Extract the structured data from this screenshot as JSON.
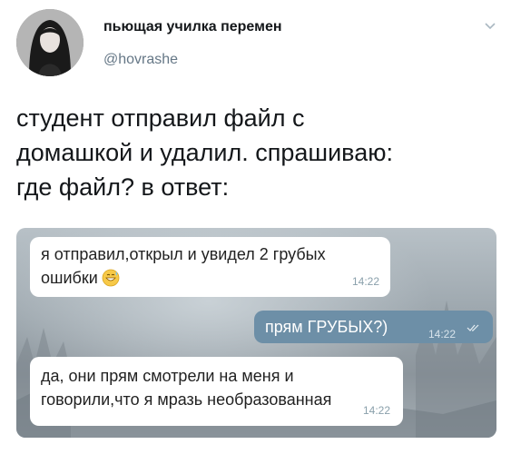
{
  "tweet": {
    "display_name": "пьющая училка перемен",
    "handle": "@hovrashe",
    "text": "студент отправил файл с\nдомашкой и удалил. спрашиваю:\nгде файл? в ответ:",
    "menu_icon": "chevron-down-icon"
  },
  "chat": {
    "messages": [
      {
        "direction": "incoming",
        "text": "я отправил,открыл и увидел 2 грубых\nошибки",
        "emoji": "grinning-sweat-emoji",
        "time": "14:22"
      },
      {
        "direction": "outgoing",
        "text": "прям ГРУБЫХ?)",
        "time": "14:22",
        "status_icon": "double-check-icon"
      },
      {
        "direction": "incoming",
        "text": "да, они прям смотрели на меня и\nговорили,что я мразь необразованная",
        "time": "14:22"
      }
    ]
  },
  "colors": {
    "outgoing_bubble": "#6d8fa7",
    "incoming_bubble": "#ffffff",
    "handle": "#657786"
  }
}
